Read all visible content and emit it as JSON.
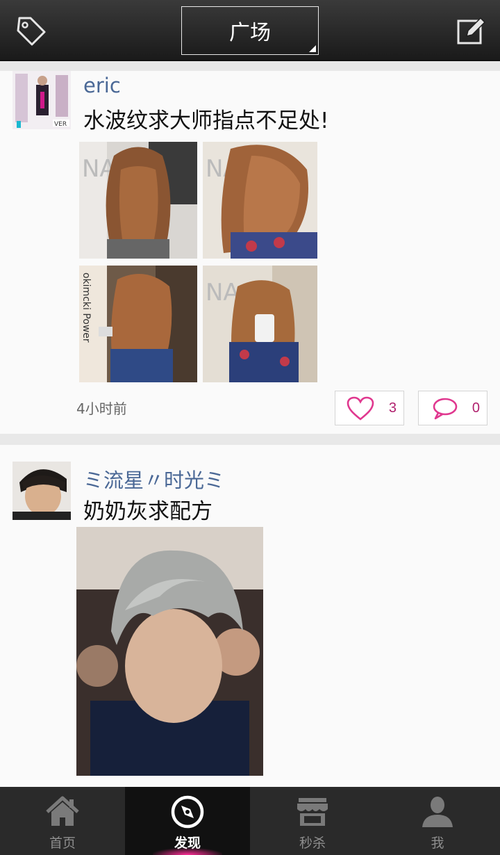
{
  "header": {
    "title": "广场",
    "left_icon": "tag-icon",
    "right_icon": "compose-icon"
  },
  "feed": {
    "posts": [
      {
        "username": "eric",
        "content": "水波纹求大师指点不足处!",
        "time": "4小时前",
        "likes": "3",
        "comments": "0"
      },
      {
        "username": "ミ流星〃时光ミ",
        "content": "奶奶灰求配方"
      }
    ]
  },
  "tabs": [
    {
      "label": "首页",
      "icon": "home-icon"
    },
    {
      "label": "发现",
      "icon": "compass-icon",
      "active": true
    },
    {
      "label": "秒杀",
      "icon": "store-icon"
    },
    {
      "label": "我",
      "icon": "person-icon"
    }
  ],
  "colors": {
    "accent": "#e0388f",
    "username": "#4a6896",
    "header_bg": "#1f1f1f"
  }
}
